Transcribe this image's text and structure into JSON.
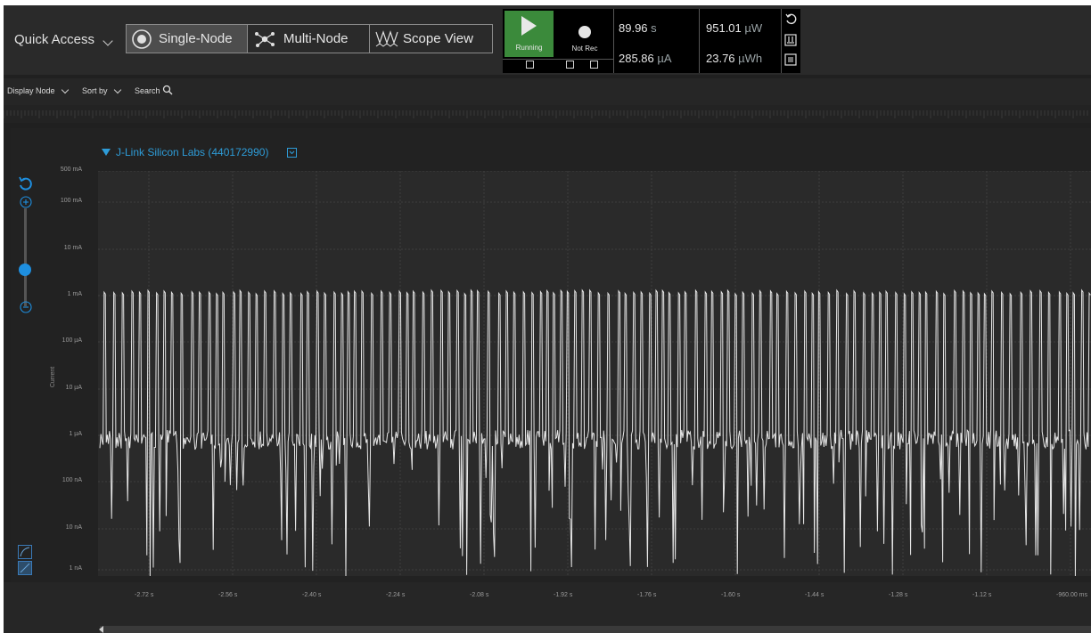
{
  "toolbar": {
    "quick_access": "Quick Access",
    "modes": [
      {
        "label": "Single-Node",
        "active": true
      },
      {
        "label": "Multi-Node",
        "active": false
      },
      {
        "label": "Scope View",
        "active": false
      }
    ],
    "run_label": "Running",
    "record_label": "Not Rec",
    "stats": {
      "time": "89.96",
      "time_unit": "s",
      "current": "285.86",
      "current_unit": "µA",
      "power": "951.01",
      "power_unit": "µW",
      "energy": "23.76",
      "energy_unit": "µWh"
    }
  },
  "secondary_toolbar": {
    "display_node": "Display Node",
    "sort_by": "Sort by",
    "search": "Search"
  },
  "chart_data": {
    "type": "line",
    "device": "J-Link Silicon Labs (440172990)",
    "ylabel": "Current",
    "y_scale": "log",
    "ylim": [
      "1 nA",
      "500 mA"
    ],
    "y_ticks": [
      "500 mA",
      "100 mA",
      "10 mA",
      "1 mA",
      "100 µA",
      "10 µA",
      "1 µA",
      "100 nA",
      "10 nA",
      "1 nA"
    ],
    "x_ticks": [
      "-2.72 s",
      "-2.56 s",
      "-2.40 s",
      "-2.24 s",
      "-2.08 s",
      "-1.92 s",
      "-1.76 s",
      "-1.60 s",
      "-1.44 s",
      "-1.28 s",
      "-1.12 s",
      "-960.00 ms"
    ],
    "grid": true,
    "description_values": {
      "pulse_peak": "1.5 mA",
      "baseline": "1 µA",
      "dips_to": "1 nA"
    }
  },
  "colors": {
    "accent": "#2e9cd8",
    "run": "#3b8a3b",
    "trace": "#e6e6e6",
    "background": "#202020"
  }
}
